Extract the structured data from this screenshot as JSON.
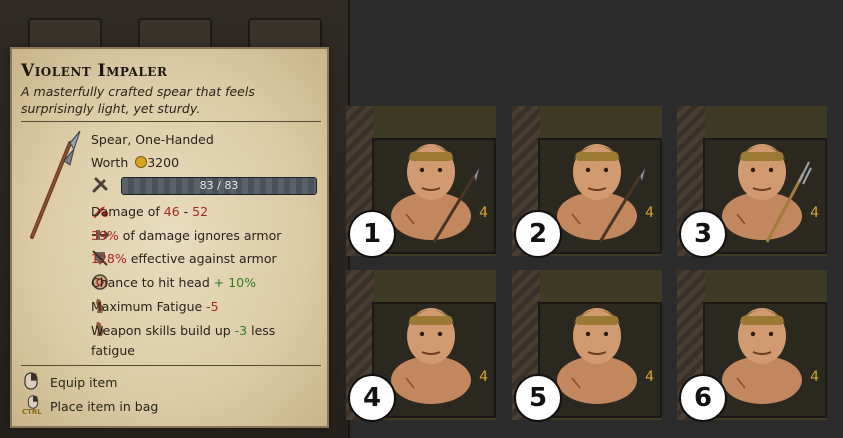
{
  "tooltip": {
    "title": "Violent Impaler",
    "description": "A masterfully crafted spear that feels surprisingly light, yet sturdy.",
    "type": "Spear, One-Handed",
    "worth_label": "Worth",
    "worth_value": "3200",
    "condition_text": "83 / 83",
    "condition_fraction": 1.0,
    "stats": {
      "damage_prefix": "Damage of ",
      "damage_min": "46",
      "damage_sep": " - ",
      "damage_max": "52",
      "ignore_pct": "39%",
      "ignore_suffix": " of damage ignores armor",
      "armor_pct": "128%",
      "armor_suffix": " effective against armor",
      "head_prefix": "Chance to hit head ",
      "head_value": "+ 10%",
      "fatigue_prefix": "Maximum Fatigue ",
      "fatigue_value": "-5",
      "skills_prefix": "Weapon skills build up ",
      "skills_value": "-3",
      "skills_suffix_1": " less",
      "skills_suffix_2": "fatigue"
    },
    "hints": {
      "equip": "Equip item",
      "bag": "Place item in bag",
      "ctrl_key": "CTRL"
    }
  },
  "cards": [
    {
      "badge": "1",
      "level": "4",
      "weapon": "spear"
    },
    {
      "badge": "2",
      "level": "4",
      "weapon": "spear"
    },
    {
      "badge": "3",
      "level": "4",
      "weapon": "pitchfork"
    },
    {
      "badge": "4",
      "level": "4",
      "weapon": "none"
    },
    {
      "badge": "5",
      "level": "4",
      "weapon": "none"
    },
    {
      "badge": "6",
      "level": "4",
      "weapon": "none"
    }
  ],
  "colors": {
    "parchment": "#dccba6",
    "negative": "#a8281c",
    "positive": "#2f7a22",
    "level": "#d8a52b"
  }
}
